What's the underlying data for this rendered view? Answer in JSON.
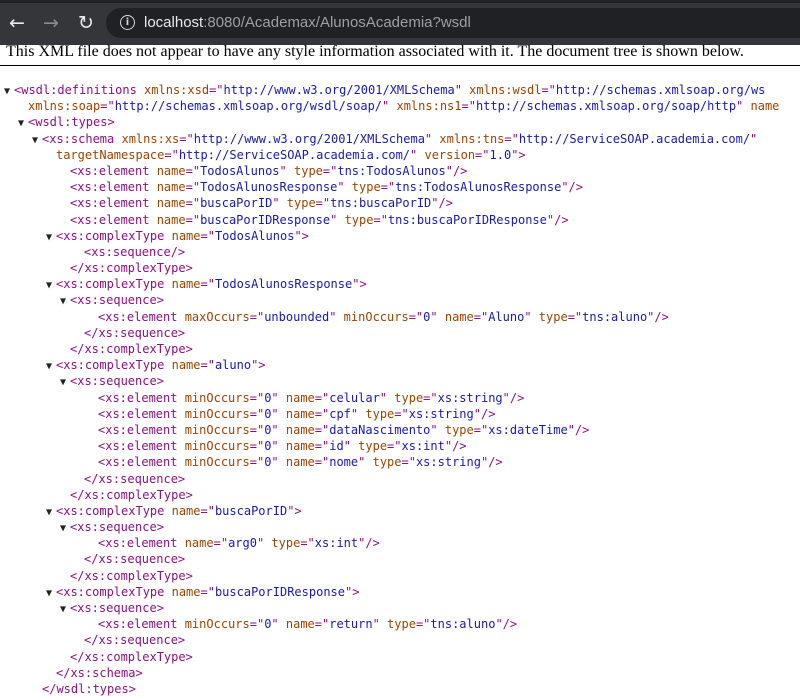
{
  "browser": {
    "back_glyph": "←",
    "forward_glyph": "→",
    "reload_glyph": "↻",
    "info_glyph": "i",
    "url_host": "localhost",
    "url_rest": ":8080/Academax/AlunosAcademia?wsdl"
  },
  "notice": "This XML file does not appear to have any style information associated with it. The document tree is shown below.",
  "tree": [
    {
      "indent": 0,
      "arrow": "▼",
      "parts": [
        {
          "c": "tag",
          "t": "<wsdl:definitions"
        },
        {
          "c": "attr",
          "t": " xmlns:xsd"
        },
        {
          "c": "tag",
          "t": "=\""
        },
        {
          "c": "val",
          "t": "http://www.w3.org/2001/XMLSchema"
        },
        {
          "c": "tag",
          "t": "\""
        },
        {
          "c": "attr",
          "t": " xmlns:wsdl"
        },
        {
          "c": "tag",
          "t": "=\""
        },
        {
          "c": "val",
          "t": "http://schemas.xmlsoap.org/ws"
        }
      ]
    },
    {
      "indent": 1,
      "arrow": "",
      "parts": [
        {
          "c": "attr",
          "t": "xmlns:soap"
        },
        {
          "c": "tag",
          "t": "=\""
        },
        {
          "c": "val",
          "t": "http://schemas.xmlsoap.org/wsdl/soap/"
        },
        {
          "c": "tag",
          "t": "\""
        },
        {
          "c": "attr",
          "t": " xmlns:ns1"
        },
        {
          "c": "tag",
          "t": "=\""
        },
        {
          "c": "val",
          "t": "http://schemas.xmlsoap.org/soap/http"
        },
        {
          "c": "tag",
          "t": "\""
        },
        {
          "c": "attr",
          "t": " name"
        }
      ]
    },
    {
      "indent": 1,
      "arrow": "▼",
      "parts": [
        {
          "c": "tag",
          "t": "<wsdl:types>"
        }
      ]
    },
    {
      "indent": 2,
      "arrow": "▼",
      "parts": [
        {
          "c": "tag",
          "t": "<xs:schema"
        },
        {
          "c": "attr",
          "t": " xmlns:xs"
        },
        {
          "c": "tag",
          "t": "=\""
        },
        {
          "c": "val",
          "t": "http://www.w3.org/2001/XMLSchema"
        },
        {
          "c": "tag",
          "t": "\""
        },
        {
          "c": "attr",
          "t": " xmlns:tns"
        },
        {
          "c": "tag",
          "t": "=\""
        },
        {
          "c": "val",
          "t": "http://ServiceSOAP.academia.com/"
        },
        {
          "c": "tag",
          "t": "\""
        }
      ]
    },
    {
      "indent": 3,
      "arrow": "",
      "parts": [
        {
          "c": "attr",
          "t": "targetNamespace"
        },
        {
          "c": "tag",
          "t": "=\""
        },
        {
          "c": "val",
          "t": "http://ServiceSOAP.academia.com/"
        },
        {
          "c": "tag",
          "t": "\""
        },
        {
          "c": "attr",
          "t": " version"
        },
        {
          "c": "tag",
          "t": "=\""
        },
        {
          "c": "val",
          "t": "1.0"
        },
        {
          "c": "tag",
          "t": "\">"
        }
      ]
    },
    {
      "indent": 4,
      "arrow": "",
      "parts": [
        {
          "c": "tag",
          "t": "<xs:element"
        },
        {
          "c": "attr",
          "t": " name"
        },
        {
          "c": "tag",
          "t": "=\""
        },
        {
          "c": "val",
          "t": "TodosAlunos"
        },
        {
          "c": "tag",
          "t": "\""
        },
        {
          "c": "attr",
          "t": " type"
        },
        {
          "c": "tag",
          "t": "=\""
        },
        {
          "c": "val",
          "t": "tns:TodosAlunos"
        },
        {
          "c": "tag",
          "t": "\"/>"
        }
      ]
    },
    {
      "indent": 4,
      "arrow": "",
      "parts": [
        {
          "c": "tag",
          "t": "<xs:element"
        },
        {
          "c": "attr",
          "t": " name"
        },
        {
          "c": "tag",
          "t": "=\""
        },
        {
          "c": "val",
          "t": "TodosAlunosResponse"
        },
        {
          "c": "tag",
          "t": "\""
        },
        {
          "c": "attr",
          "t": " type"
        },
        {
          "c": "tag",
          "t": "=\""
        },
        {
          "c": "val",
          "t": "tns:TodosAlunosResponse"
        },
        {
          "c": "tag",
          "t": "\"/>"
        }
      ]
    },
    {
      "indent": 4,
      "arrow": "",
      "parts": [
        {
          "c": "tag",
          "t": "<xs:element"
        },
        {
          "c": "attr",
          "t": " name"
        },
        {
          "c": "tag",
          "t": "=\""
        },
        {
          "c": "val",
          "t": "buscaPorID"
        },
        {
          "c": "tag",
          "t": "\""
        },
        {
          "c": "attr",
          "t": " type"
        },
        {
          "c": "tag",
          "t": "=\""
        },
        {
          "c": "val",
          "t": "tns:buscaPorID"
        },
        {
          "c": "tag",
          "t": "\"/>"
        }
      ]
    },
    {
      "indent": 4,
      "arrow": "",
      "parts": [
        {
          "c": "tag",
          "t": "<xs:element"
        },
        {
          "c": "attr",
          "t": " name"
        },
        {
          "c": "tag",
          "t": "=\""
        },
        {
          "c": "val",
          "t": "buscaPorIDResponse"
        },
        {
          "c": "tag",
          "t": "\""
        },
        {
          "c": "attr",
          "t": " type"
        },
        {
          "c": "tag",
          "t": "=\""
        },
        {
          "c": "val",
          "t": "tns:buscaPorIDResponse"
        },
        {
          "c": "tag",
          "t": "\"/>"
        }
      ]
    },
    {
      "indent": 3,
      "arrow": "▼",
      "parts": [
        {
          "c": "tag",
          "t": "<xs:complexType"
        },
        {
          "c": "attr",
          "t": " name"
        },
        {
          "c": "tag",
          "t": "=\""
        },
        {
          "c": "val",
          "t": "TodosAlunos"
        },
        {
          "c": "tag",
          "t": "\">"
        }
      ]
    },
    {
      "indent": 5,
      "arrow": "",
      "parts": [
        {
          "c": "tag",
          "t": "<xs:sequence/>"
        }
      ]
    },
    {
      "indent": 4,
      "arrow": "",
      "parts": [
        {
          "c": "tag",
          "t": "</xs:complexType>"
        }
      ]
    },
    {
      "indent": 3,
      "arrow": "▼",
      "parts": [
        {
          "c": "tag",
          "t": "<xs:complexType"
        },
        {
          "c": "attr",
          "t": " name"
        },
        {
          "c": "tag",
          "t": "=\""
        },
        {
          "c": "val",
          "t": "TodosAlunosResponse"
        },
        {
          "c": "tag",
          "t": "\">"
        }
      ]
    },
    {
      "indent": 4,
      "arrow": "▼",
      "parts": [
        {
          "c": "tag",
          "t": "<xs:sequence>"
        }
      ]
    },
    {
      "indent": 6,
      "arrow": "",
      "parts": [
        {
          "c": "tag",
          "t": "<xs:element"
        },
        {
          "c": "attr",
          "t": " maxOccurs"
        },
        {
          "c": "tag",
          "t": "=\""
        },
        {
          "c": "val",
          "t": "unbounded"
        },
        {
          "c": "tag",
          "t": "\""
        },
        {
          "c": "attr",
          "t": " minOccurs"
        },
        {
          "c": "tag",
          "t": "=\""
        },
        {
          "c": "val",
          "t": "0"
        },
        {
          "c": "tag",
          "t": "\""
        },
        {
          "c": "attr",
          "t": " name"
        },
        {
          "c": "tag",
          "t": "=\""
        },
        {
          "c": "val",
          "t": "Aluno"
        },
        {
          "c": "tag",
          "t": "\""
        },
        {
          "c": "attr",
          "t": " type"
        },
        {
          "c": "tag",
          "t": "=\""
        },
        {
          "c": "val",
          "t": "tns:aluno"
        },
        {
          "c": "tag",
          "t": "\"/>"
        }
      ]
    },
    {
      "indent": 5,
      "arrow": "",
      "parts": [
        {
          "c": "tag",
          "t": "</xs:sequence>"
        }
      ]
    },
    {
      "indent": 4,
      "arrow": "",
      "parts": [
        {
          "c": "tag",
          "t": "</xs:complexType>"
        }
      ]
    },
    {
      "indent": 3,
      "arrow": "▼",
      "parts": [
        {
          "c": "tag",
          "t": "<xs:complexType"
        },
        {
          "c": "attr",
          "t": " name"
        },
        {
          "c": "tag",
          "t": "=\""
        },
        {
          "c": "val",
          "t": "aluno"
        },
        {
          "c": "tag",
          "t": "\">"
        }
      ]
    },
    {
      "indent": 4,
      "arrow": "▼",
      "parts": [
        {
          "c": "tag",
          "t": "<xs:sequence>"
        }
      ]
    },
    {
      "indent": 6,
      "arrow": "",
      "parts": [
        {
          "c": "tag",
          "t": "<xs:element"
        },
        {
          "c": "attr",
          "t": " minOccurs"
        },
        {
          "c": "tag",
          "t": "=\""
        },
        {
          "c": "val",
          "t": "0"
        },
        {
          "c": "tag",
          "t": "\""
        },
        {
          "c": "attr",
          "t": " name"
        },
        {
          "c": "tag",
          "t": "=\""
        },
        {
          "c": "val",
          "t": "celular"
        },
        {
          "c": "tag",
          "t": "\""
        },
        {
          "c": "attr",
          "t": " type"
        },
        {
          "c": "tag",
          "t": "=\""
        },
        {
          "c": "val",
          "t": "xs:string"
        },
        {
          "c": "tag",
          "t": "\"/>"
        }
      ]
    },
    {
      "indent": 6,
      "arrow": "",
      "parts": [
        {
          "c": "tag",
          "t": "<xs:element"
        },
        {
          "c": "attr",
          "t": " minOccurs"
        },
        {
          "c": "tag",
          "t": "=\""
        },
        {
          "c": "val",
          "t": "0"
        },
        {
          "c": "tag",
          "t": "\""
        },
        {
          "c": "attr",
          "t": " name"
        },
        {
          "c": "tag",
          "t": "=\""
        },
        {
          "c": "val",
          "t": "cpf"
        },
        {
          "c": "tag",
          "t": "\""
        },
        {
          "c": "attr",
          "t": " type"
        },
        {
          "c": "tag",
          "t": "=\""
        },
        {
          "c": "val",
          "t": "xs:string"
        },
        {
          "c": "tag",
          "t": "\"/>"
        }
      ]
    },
    {
      "indent": 6,
      "arrow": "",
      "parts": [
        {
          "c": "tag",
          "t": "<xs:element"
        },
        {
          "c": "attr",
          "t": " minOccurs"
        },
        {
          "c": "tag",
          "t": "=\""
        },
        {
          "c": "val",
          "t": "0"
        },
        {
          "c": "tag",
          "t": "\""
        },
        {
          "c": "attr",
          "t": " name"
        },
        {
          "c": "tag",
          "t": "=\""
        },
        {
          "c": "val",
          "t": "dataNascimento"
        },
        {
          "c": "tag",
          "t": "\""
        },
        {
          "c": "attr",
          "t": " type"
        },
        {
          "c": "tag",
          "t": "=\""
        },
        {
          "c": "val",
          "t": "xs:dateTime"
        },
        {
          "c": "tag",
          "t": "\"/>"
        }
      ]
    },
    {
      "indent": 6,
      "arrow": "",
      "parts": [
        {
          "c": "tag",
          "t": "<xs:element"
        },
        {
          "c": "attr",
          "t": " minOccurs"
        },
        {
          "c": "tag",
          "t": "=\""
        },
        {
          "c": "val",
          "t": "0"
        },
        {
          "c": "tag",
          "t": "\""
        },
        {
          "c": "attr",
          "t": " name"
        },
        {
          "c": "tag",
          "t": "=\""
        },
        {
          "c": "val",
          "t": "id"
        },
        {
          "c": "tag",
          "t": "\""
        },
        {
          "c": "attr",
          "t": " type"
        },
        {
          "c": "tag",
          "t": "=\""
        },
        {
          "c": "val",
          "t": "xs:int"
        },
        {
          "c": "tag",
          "t": "\"/>"
        }
      ]
    },
    {
      "indent": 6,
      "arrow": "",
      "parts": [
        {
          "c": "tag",
          "t": "<xs:element"
        },
        {
          "c": "attr",
          "t": " minOccurs"
        },
        {
          "c": "tag",
          "t": "=\""
        },
        {
          "c": "val",
          "t": "0"
        },
        {
          "c": "tag",
          "t": "\""
        },
        {
          "c": "attr",
          "t": " name"
        },
        {
          "c": "tag",
          "t": "=\""
        },
        {
          "c": "val",
          "t": "nome"
        },
        {
          "c": "tag",
          "t": "\""
        },
        {
          "c": "attr",
          "t": " type"
        },
        {
          "c": "tag",
          "t": "=\""
        },
        {
          "c": "val",
          "t": "xs:string"
        },
        {
          "c": "tag",
          "t": "\"/>"
        }
      ]
    },
    {
      "indent": 5,
      "arrow": "",
      "parts": [
        {
          "c": "tag",
          "t": "</xs:sequence>"
        }
      ]
    },
    {
      "indent": 4,
      "arrow": "",
      "parts": [
        {
          "c": "tag",
          "t": "</xs:complexType>"
        }
      ]
    },
    {
      "indent": 3,
      "arrow": "▼",
      "parts": [
        {
          "c": "tag",
          "t": "<xs:complexType"
        },
        {
          "c": "attr",
          "t": " name"
        },
        {
          "c": "tag",
          "t": "=\""
        },
        {
          "c": "val",
          "t": "buscaPorID"
        },
        {
          "c": "tag",
          "t": "\">"
        }
      ]
    },
    {
      "indent": 4,
      "arrow": "▼",
      "parts": [
        {
          "c": "tag",
          "t": "<xs:sequence>"
        }
      ]
    },
    {
      "indent": 6,
      "arrow": "",
      "parts": [
        {
          "c": "tag",
          "t": "<xs:element"
        },
        {
          "c": "attr",
          "t": " name"
        },
        {
          "c": "tag",
          "t": "=\""
        },
        {
          "c": "val",
          "t": "arg0"
        },
        {
          "c": "tag",
          "t": "\""
        },
        {
          "c": "attr",
          "t": " type"
        },
        {
          "c": "tag",
          "t": "=\""
        },
        {
          "c": "val",
          "t": "xs:int"
        },
        {
          "c": "tag",
          "t": "\"/>"
        }
      ]
    },
    {
      "indent": 5,
      "arrow": "",
      "parts": [
        {
          "c": "tag",
          "t": "</xs:sequence>"
        }
      ]
    },
    {
      "indent": 4,
      "arrow": "",
      "parts": [
        {
          "c": "tag",
          "t": "</xs:complexType>"
        }
      ]
    },
    {
      "indent": 3,
      "arrow": "▼",
      "parts": [
        {
          "c": "tag",
          "t": "<xs:complexType"
        },
        {
          "c": "attr",
          "t": " name"
        },
        {
          "c": "tag",
          "t": "=\""
        },
        {
          "c": "val",
          "t": "buscaPorIDResponse"
        },
        {
          "c": "tag",
          "t": "\">"
        }
      ]
    },
    {
      "indent": 4,
      "arrow": "▼",
      "parts": [
        {
          "c": "tag",
          "t": "<xs:sequence>"
        }
      ]
    },
    {
      "indent": 6,
      "arrow": "",
      "parts": [
        {
          "c": "tag",
          "t": "<xs:element"
        },
        {
          "c": "attr",
          "t": " minOccurs"
        },
        {
          "c": "tag",
          "t": "=\""
        },
        {
          "c": "val",
          "t": "0"
        },
        {
          "c": "tag",
          "t": "\""
        },
        {
          "c": "attr",
          "t": " name"
        },
        {
          "c": "tag",
          "t": "=\""
        },
        {
          "c": "val",
          "t": "return"
        },
        {
          "c": "tag",
          "t": "\""
        },
        {
          "c": "attr",
          "t": " type"
        },
        {
          "c": "tag",
          "t": "=\""
        },
        {
          "c": "val",
          "t": "tns:aluno"
        },
        {
          "c": "tag",
          "t": "\"/>"
        }
      ]
    },
    {
      "indent": 5,
      "arrow": "",
      "parts": [
        {
          "c": "tag",
          "t": "</xs:sequence>"
        }
      ]
    },
    {
      "indent": 4,
      "arrow": "",
      "parts": [
        {
          "c": "tag",
          "t": "</xs:complexType>"
        }
      ]
    },
    {
      "indent": 3,
      "arrow": "",
      "parts": [
        {
          "c": "tag",
          "t": "</xs:schema>"
        }
      ]
    },
    {
      "indent": 2,
      "arrow": "",
      "parts": [
        {
          "c": "tag",
          "t": "</wsdl:types>"
        }
      ]
    }
  ]
}
